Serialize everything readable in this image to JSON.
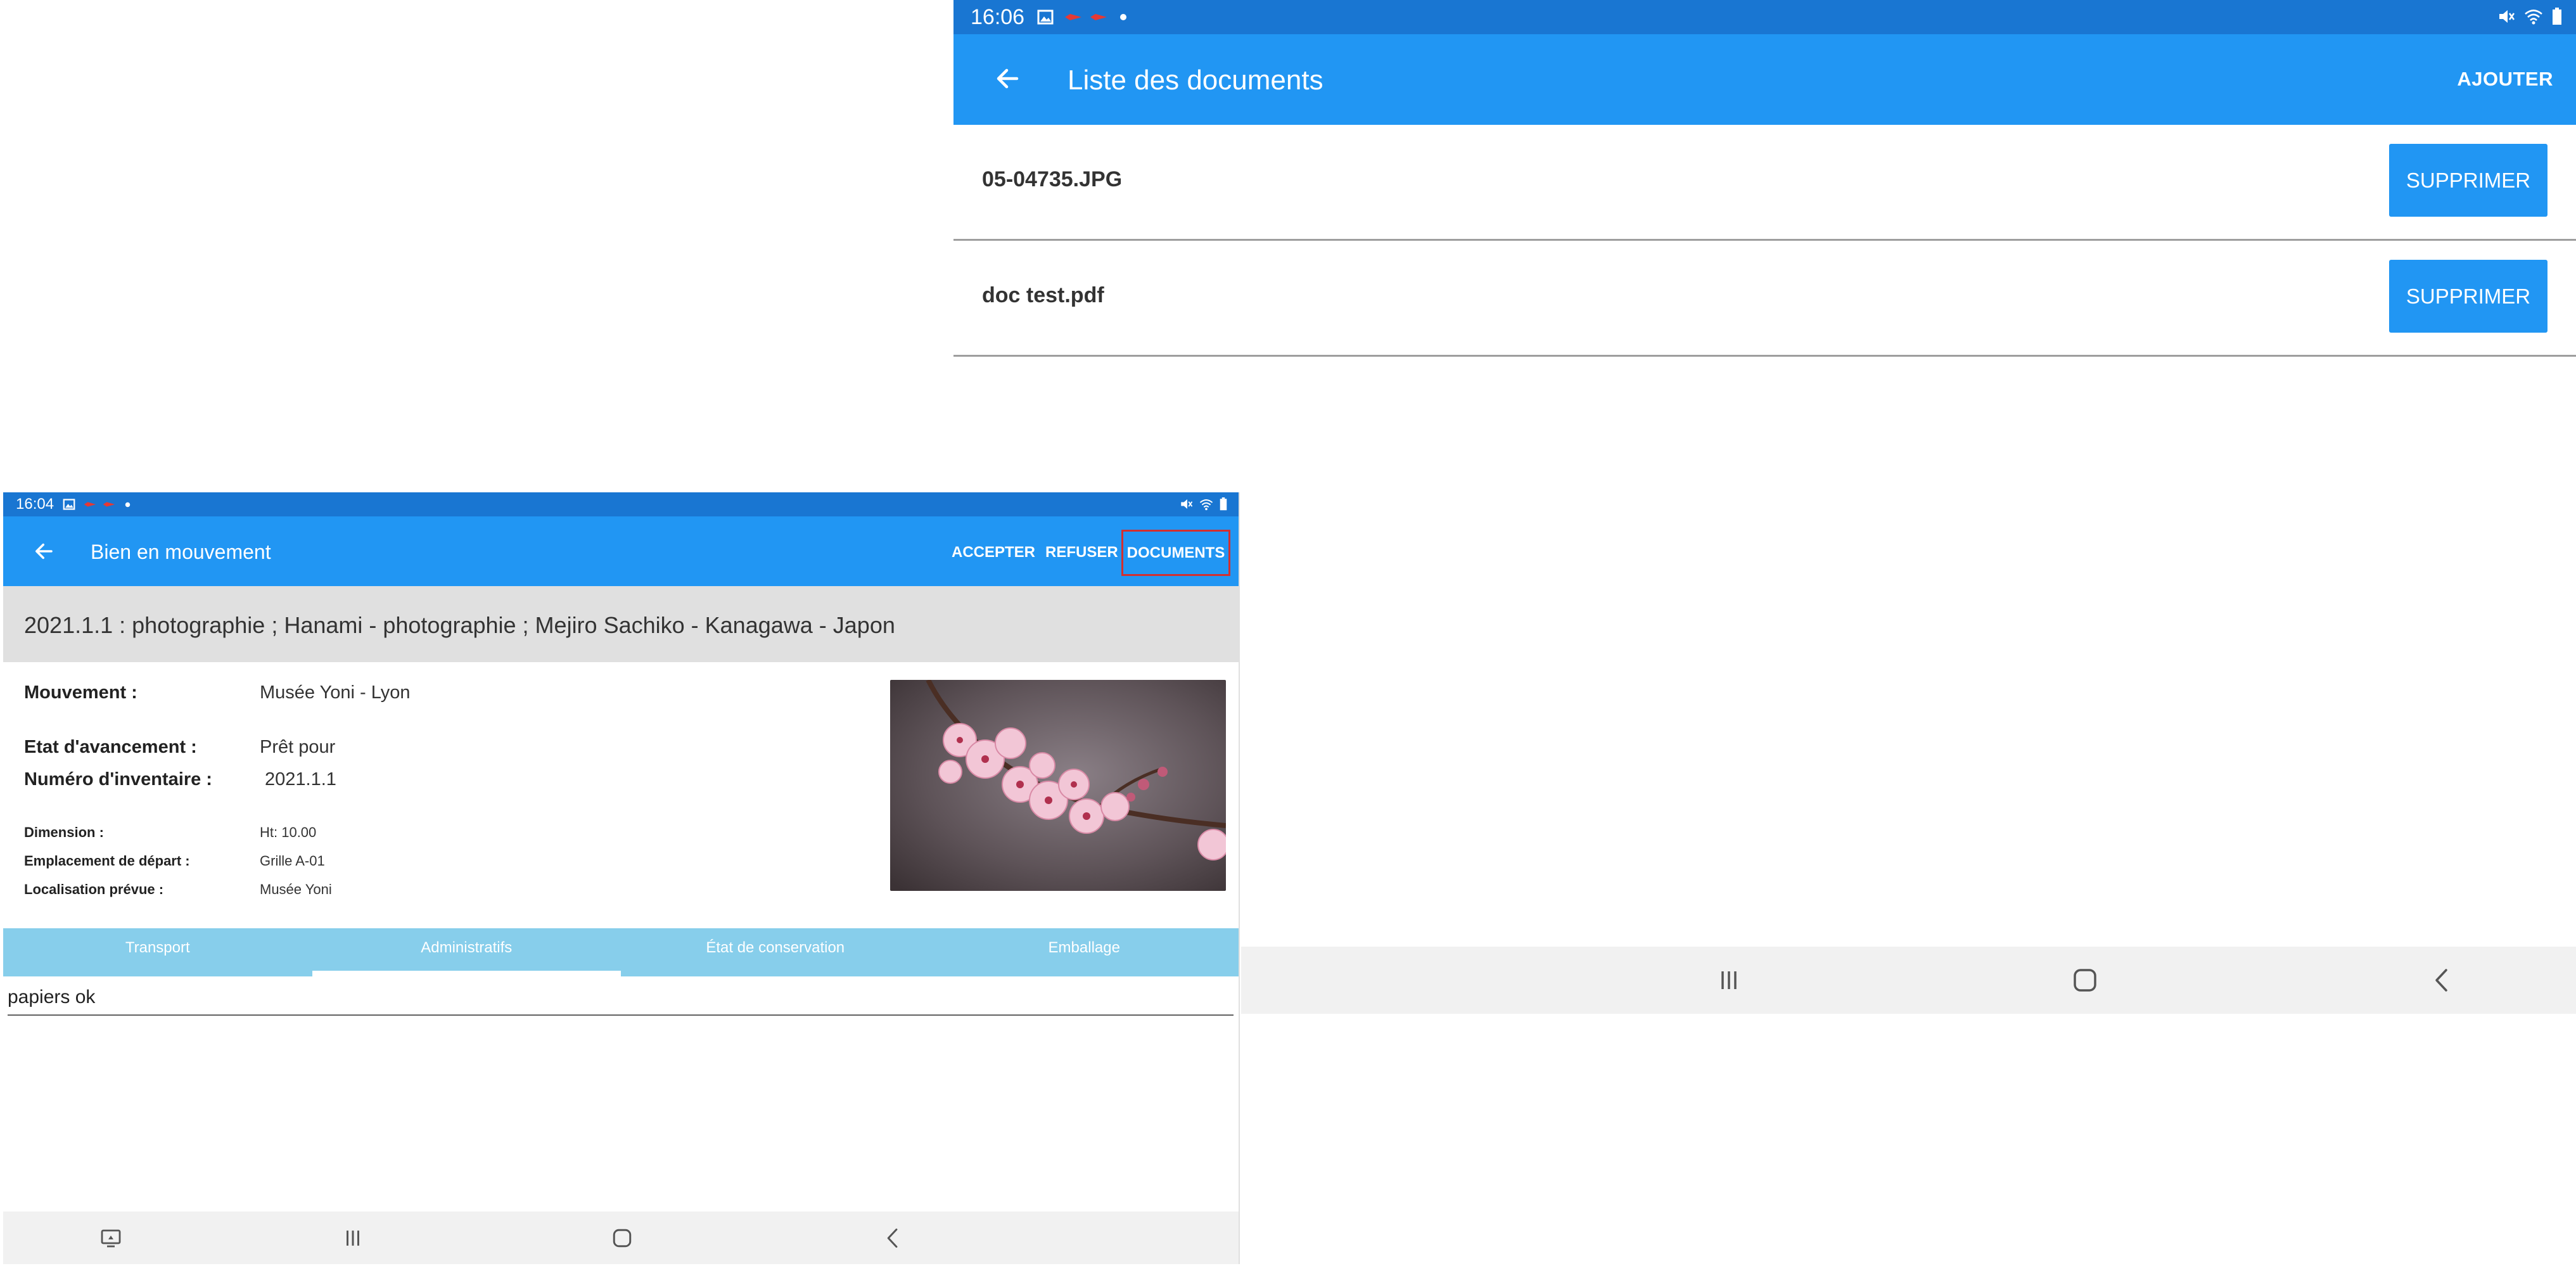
{
  "right_screen": {
    "status_bar": {
      "time": "16:06"
    },
    "app_bar": {
      "title": "Liste des documents",
      "action": "AJOUTER"
    },
    "documents": [
      {
        "name": "05-04735.JPG",
        "action": "SUPPRIMER"
      },
      {
        "name": "doc test.pdf",
        "action": "SUPPRIMER"
      }
    ]
  },
  "left_screen": {
    "status_bar": {
      "time": "16:04"
    },
    "app_bar": {
      "title": "Bien en mouvement",
      "actions": {
        "accept": "ACCEPTER",
        "refuse": "REFUSER",
        "documents": "DOCUMENTS"
      }
    },
    "header": "2021.1.1 : photographie ; Hanami - photographie ; Mejiro Sachiko - Kanagawa - Japon",
    "details": {
      "mouvement": {
        "label": "Mouvement :",
        "value": "Musée Yoni - Lyon"
      },
      "etat": {
        "label": "Etat d'avancement :",
        "value": "Prêt pour"
      },
      "inventaire": {
        "label": "Numéro d'inventaire :",
        "value": "2021.1.1"
      },
      "dimension": {
        "label": "Dimension :",
        "value": "Ht: 10.00"
      },
      "emplacement": {
        "label": "Emplacement de départ :",
        "value": "Grille A-01"
      },
      "localisation": {
        "label": "Localisation prévue :",
        "value": "Musée Yoni"
      }
    },
    "tabs": [
      {
        "label": "Transport",
        "selected": false
      },
      {
        "label": "Administratifs",
        "selected": true
      },
      {
        "label": "État de conservation",
        "selected": false
      },
      {
        "label": "Emballage",
        "selected": false
      }
    ],
    "note_value": "papiers ok"
  },
  "icons": {
    "back": "arrow-left-icon",
    "status_left": [
      "gallery-icon",
      "notification-icon",
      "notification-icon",
      "dot-icon"
    ],
    "status_right": [
      "mute-icon",
      "wifi-icon",
      "battery-icon"
    ],
    "nav": [
      "recents-icon",
      "home-icon",
      "back-chevron-icon"
    ]
  },
  "colors": {
    "status_bar": "#1976d2",
    "app_bar": "#2196f3",
    "tab_bar": "#87ceeb",
    "highlight": "#d32f2f"
  }
}
